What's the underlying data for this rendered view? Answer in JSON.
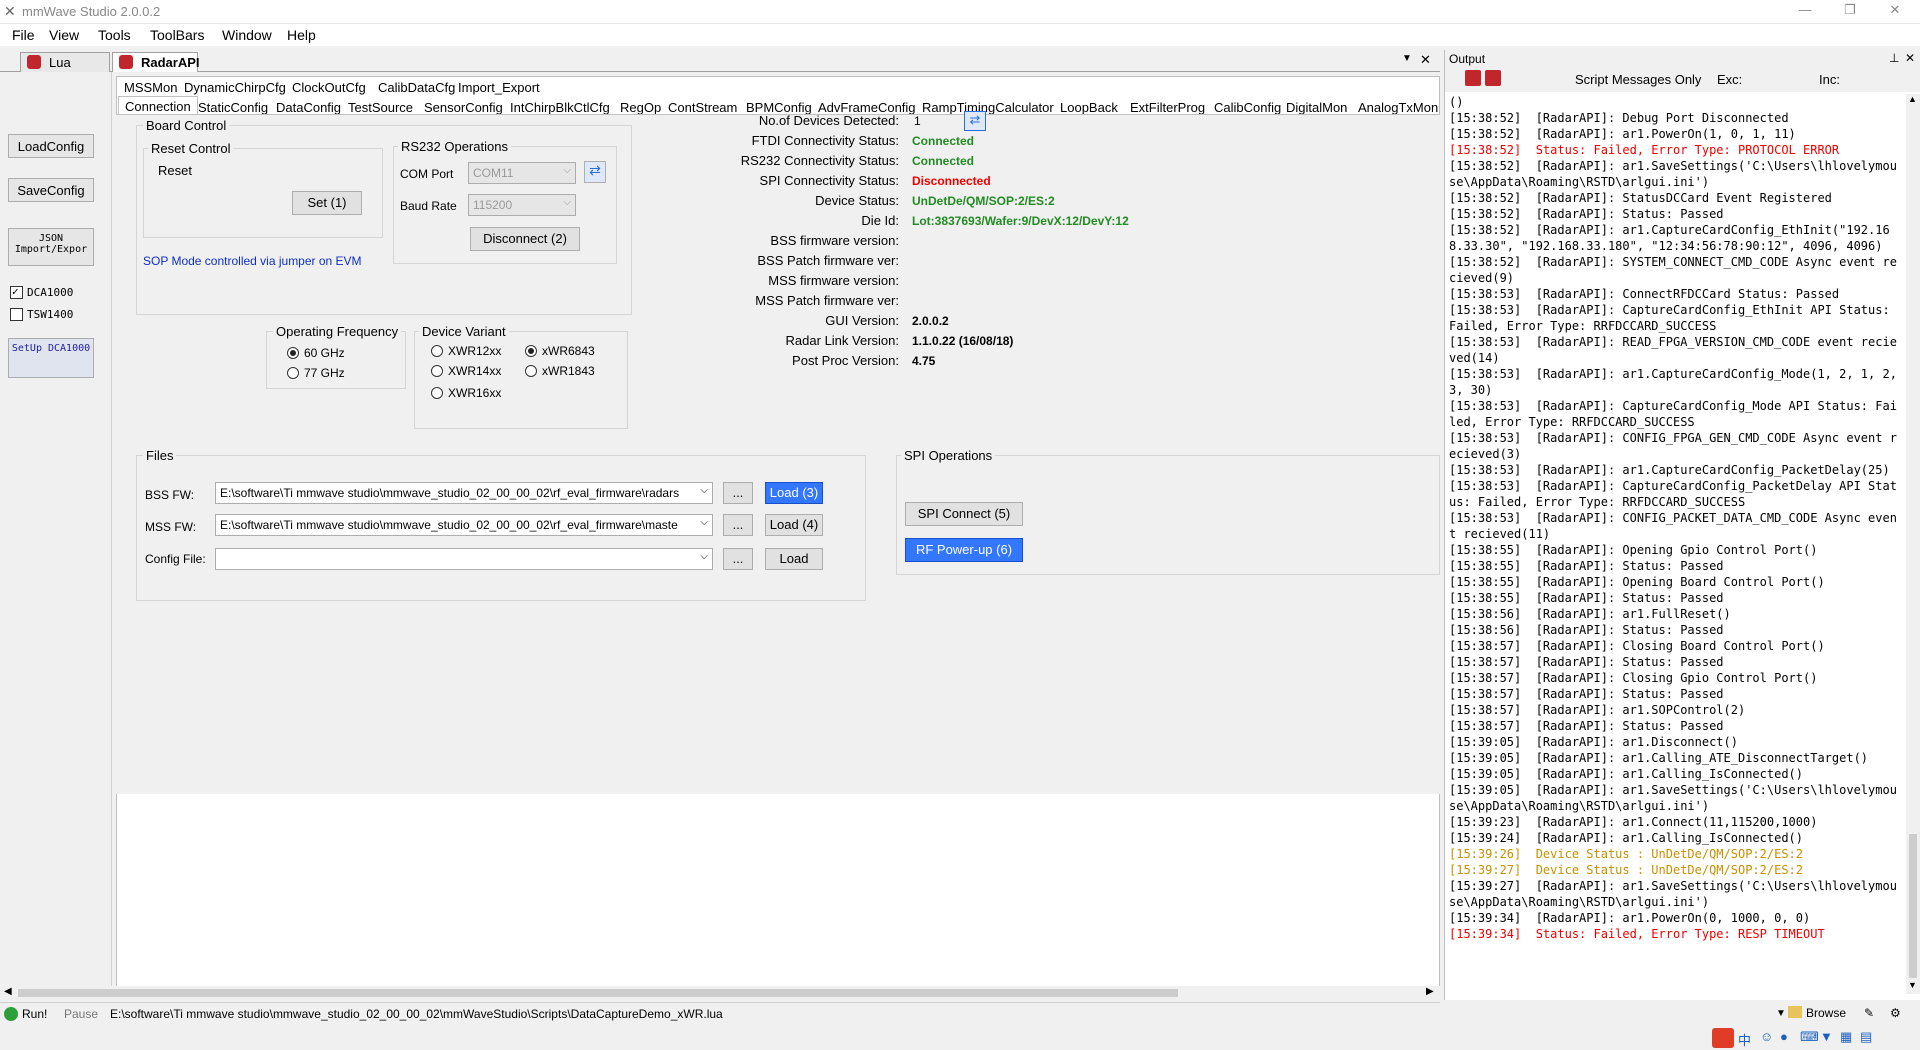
{
  "window": {
    "title": "mmWave Studio 2.0.0.2",
    "min": "—",
    "restore": "❐",
    "close": "✕"
  },
  "menu": [
    "File",
    "View",
    "Tools",
    "ToolBars",
    "Window",
    "Help"
  ],
  "doc_tabs": [
    "Lua Shell",
    "RadarAPI"
  ],
  "doc_controls": {
    "dropdown": "▼",
    "close": "✕"
  },
  "left": {
    "load_config": "LoadConfig",
    "save_config": "SaveConfig",
    "json": "JSON Import/Expor",
    "dca1000": "DCA1000",
    "tsw1400": "TSW1400",
    "setup": "SetUp DCA1000"
  },
  "tabs_row1": [
    "MSSMon",
    "DynamicChirpCfg",
    "ClockOutCfg",
    "CalibDataCfg",
    "Import_Export"
  ],
  "tabs_row2": [
    "Connection",
    "StaticConfig",
    "DataConfig",
    "TestSource",
    "SensorConfig",
    "IntChirpBlkCtlCfg",
    "RegOp",
    "ContStream",
    "BPMConfig",
    "AdvFrameConfig",
    "RampTimingCalculator",
    "LoopBack",
    "ExtFilterProg",
    "CalibConfig",
    "DigitalMon",
    "AnalogTxMon"
  ],
  "board": {
    "title": "Board Control",
    "reset_group": "Reset Control",
    "reset_label": "Reset",
    "set_button": "Set (1)",
    "sop_note": "SOP Mode controlled via jumper on EVM"
  },
  "rs232": {
    "title": "RS232 Operations",
    "com_label": "COM Port",
    "com_value": "COM11",
    "baud_label": "Baud Rate",
    "baud_value": "115200",
    "disconnect": "Disconnect (2)"
  },
  "status": {
    "devices_label": "No.of Devices Detected:",
    "devices_value": "1",
    "ftdi_label": "FTDI Connectivity Status:",
    "ftdi_value": "Connected",
    "rs232_label": "RS232 Connectivity Status:",
    "rs232_value": "Connected",
    "spi_label": "SPI Connectivity Status:",
    "spi_value": "Disconnected",
    "device_label": "Device Status:",
    "device_value": "UnDetDe/QM/SOP:2/ES:2",
    "dieid_label": "Die Id:",
    "dieid_value": "Lot:3837693/Wafer:9/DevX:12/DevY:12",
    "bss_fw_label": "BSS firmware version:",
    "bss_patch_label": "BSS Patch firmware ver:",
    "mss_fw_label": "MSS firmware version:",
    "mss_patch_label": "MSS Patch firmware ver:",
    "gui_label": "GUI Version:",
    "gui_value": "2.0.0.2",
    "radar_label": "Radar Link Version:",
    "radar_value": "1.1.0.22 (16/08/18)",
    "post_label": "Post Proc Version:",
    "post_value": "4.75"
  },
  "freq": {
    "title": "Operating Frequency",
    "opt1": "60 GHz",
    "opt2": "77 GHz",
    "selected": "60 GHz"
  },
  "variant": {
    "title": "Device Variant",
    "opts": [
      "XWR12xx",
      "xWR6843",
      "XWR14xx",
      "xWR1843",
      "XWR16xx"
    ],
    "selected": "xWR6843"
  },
  "files": {
    "title": "Files",
    "bss_label": "BSS FW:",
    "bss_path": "E:\\software\\Ti mmwave studio\\mmwave_studio_02_00_00_02\\rf_eval_firmware\\radars",
    "bss_load": "Load (3)",
    "mss_label": "MSS FW:",
    "mss_path": "E:\\software\\Ti mmwave studio\\mmwave_studio_02_00_00_02\\rf_eval_firmware\\maste",
    "mss_load": "Load (4)",
    "cfg_label": "Config File:",
    "cfg_path": "",
    "cfg_load": "Load",
    "browse": "..."
  },
  "spi": {
    "title": "SPI Operations",
    "connect": "SPI Connect (5)",
    "power": "RF Power-up (6)"
  },
  "output": {
    "title": "Output",
    "filter": "Script Messages Only",
    "exc": "Exc:",
    "inc": "Inc:",
    "pin": "⊥",
    "close": "✕"
  },
  "log": [
    {
      "t": "()",
      "c": "n"
    },
    {
      "t": "[15:38:52]  [RadarAPI]: Debug Port Disconnected",
      "c": "n"
    },
    {
      "t": "[15:38:52]  [RadarAPI]: ar1.PowerOn(1, 0, 1, 11)",
      "c": "n"
    },
    {
      "t": "[15:38:52]  Status: Failed, Error Type: PROTOCOL ERROR",
      "c": "e"
    },
    {
      "t": "[15:38:52]  [RadarAPI]: ar1.SaveSettings('C:\\Users\\lhlovelymouse\\AppData\\Roaming\\RSTD\\arlgui.ini')",
      "c": "n"
    },
    {
      "t": "[15:38:52]  [RadarAPI]: StatusDCCard Event Registered",
      "c": "n"
    },
    {
      "t": "[15:38:52]  [RadarAPI]: Status: Passed",
      "c": "n"
    },
    {
      "t": "[15:38:52]  [RadarAPI]: ar1.CaptureCardConfig_EthInit(\"192.168.33.30\", \"192.168.33.180\", \"12:34:56:78:90:12\", 4096, 4096)",
      "c": "n"
    },
    {
      "t": "[15:38:52]  [RadarAPI]: SYSTEM_CONNECT_CMD_CODE Async event recieved(9)",
      "c": "n"
    },
    {
      "t": "[15:38:53]  [RadarAPI]: ConnectRFDCCard Status: Passed",
      "c": "n"
    },
    {
      "t": "[15:38:53]  [RadarAPI]: CaptureCardConfig_EthInit API Status: Failed, Error Type: RRFDCCARD_SUCCESS",
      "c": "n"
    },
    {
      "t": "[15:38:53]  [RadarAPI]: READ_FPGA_VERSION_CMD_CODE event recieved(14)",
      "c": "n"
    },
    {
      "t": "[15:38:53]  [RadarAPI]: ar1.CaptureCardConfig_Mode(1, 2, 1, 2, 3, 30)",
      "c": "n"
    },
    {
      "t": "[15:38:53]  [RadarAPI]: CaptureCardConfig_Mode API Status: Failed, Error Type: RRFDCCARD_SUCCESS",
      "c": "n"
    },
    {
      "t": "[15:38:53]  [RadarAPI]: CONFIG_FPGA_GEN_CMD_CODE Async event recieved(3)",
      "c": "n"
    },
    {
      "t": "[15:38:53]  [RadarAPI]: ar1.CaptureCardConfig_PacketDelay(25)",
      "c": "n"
    },
    {
      "t": "[15:38:53]  [RadarAPI]: CaptureCardConfig_PacketDelay API Status: Failed, Error Type: RRFDCCARD_SUCCESS",
      "c": "n"
    },
    {
      "t": "[15:38:53]  [RadarAPI]: CONFIG_PACKET_DATA_CMD_CODE Async event recieved(11)",
      "c": "n"
    },
    {
      "t": "[15:38:55]  [RadarAPI]: Opening Gpio Control Port()",
      "c": "n"
    },
    {
      "t": "[15:38:55]  [RadarAPI]: Status: Passed",
      "c": "n"
    },
    {
      "t": "[15:38:55]  [RadarAPI]: Opening Board Control Port()",
      "c": "n"
    },
    {
      "t": "[15:38:55]  [RadarAPI]: Status: Passed",
      "c": "n"
    },
    {
      "t": "[15:38:56]  [RadarAPI]: ar1.FullReset()",
      "c": "n"
    },
    {
      "t": "[15:38:56]  [RadarAPI]: Status: Passed",
      "c": "n"
    },
    {
      "t": "[15:38:57]  [RadarAPI]: Closing Board Control Port()",
      "c": "n"
    },
    {
      "t": "[15:38:57]  [RadarAPI]: Status: Passed",
      "c": "n"
    },
    {
      "t": "[15:38:57]  [RadarAPI]: Closing Gpio Control Port()",
      "c": "n"
    },
    {
      "t": "[15:38:57]  [RadarAPI]: Status: Passed",
      "c": "n"
    },
    {
      "t": "[15:38:57]  [RadarAPI]: ar1.SOPControl(2)",
      "c": "n"
    },
    {
      "t": "[15:38:57]  [RadarAPI]: Status: Passed",
      "c": "n"
    },
    {
      "t": "[15:39:05]  [RadarAPI]: ar1.Disconnect()",
      "c": "n"
    },
    {
      "t": "[15:39:05]  [RadarAPI]: ar1.Calling_ATE_DisconnectTarget()",
      "c": "n"
    },
    {
      "t": "[15:39:05]  [RadarAPI]: ar1.Calling_IsConnected()",
      "c": "n"
    },
    {
      "t": "[15:39:05]  [RadarAPI]: ar1.SaveSettings('C:\\Users\\lhlovelymouse\\AppData\\Roaming\\RSTD\\arlgui.ini')",
      "c": "n"
    },
    {
      "t": "[15:39:23]  [RadarAPI]: ar1.Connect(11,115200,1000)",
      "c": "n"
    },
    {
      "t": "[15:39:24]  [RadarAPI]: ar1.Calling_IsConnected()",
      "c": "n"
    },
    {
      "t": "[15:39:26]  Device Status : UnDetDe/QM/SOP:2/ES:2",
      "c": "w"
    },
    {
      "t": "[15:39:27]  Device Status : UnDetDe/QM/SOP:2/ES:2",
      "c": "w"
    },
    {
      "t": "[15:39:27]  [RadarAPI]: ar1.SaveSettings('C:\\Users\\lhlovelymouse\\AppData\\Roaming\\RSTD\\arlgui.ini')",
      "c": "n"
    },
    {
      "t": "[15:39:34]  [RadarAPI]: ar1.PowerOn(0, 1000, 0, 0)",
      "c": "n"
    },
    {
      "t": "[15:39:34]  Status: Failed, Error Type: RESP TIMEOUT",
      "c": "e"
    }
  ],
  "statusbar": {
    "run": "Run!",
    "pause": "Pause",
    "script": "E:\\software\\Ti mmwave studio\\mmwave_studio_02_00_00_02\\mmWaveStudio\\Scripts\\DataCaptureDemo_xWR.lua",
    "browse": "Browse"
  },
  "tray": "中"
}
